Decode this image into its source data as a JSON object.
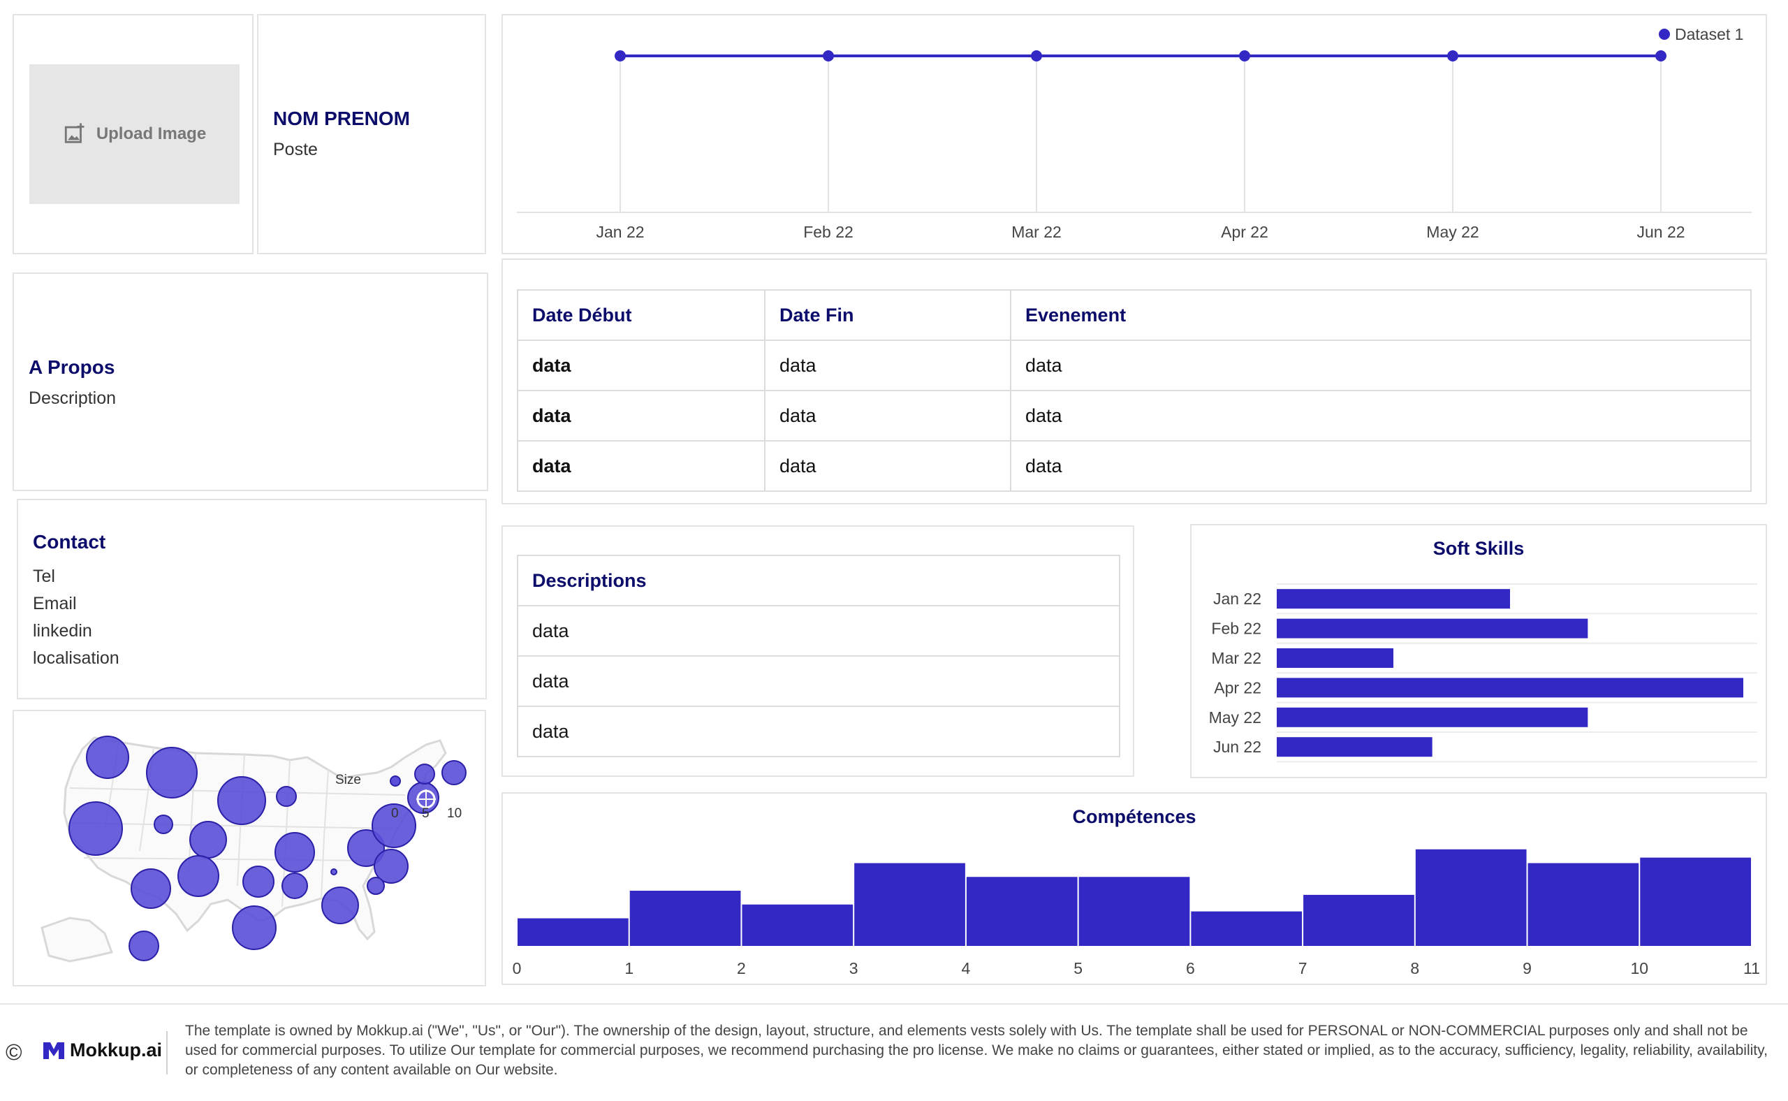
{
  "profile": {
    "upload_label": "Upload Image",
    "name": "NOM PRENOM",
    "position": "Poste"
  },
  "about": {
    "title": "A Propos",
    "description": "Description"
  },
  "contact": {
    "title": "Contact",
    "items": [
      "Tel",
      "Email",
      "linkedin",
      "localisation"
    ]
  },
  "map": {
    "legend_title": "Size",
    "legend_ticks": [
      "0",
      "5",
      "10"
    ]
  },
  "events_table": {
    "headers": [
      "Date Début",
      "Date Fin",
      "Evenement"
    ],
    "rows": [
      [
        "data",
        "data",
        "data"
      ],
      [
        "data",
        "data",
        "data"
      ],
      [
        "data",
        "data",
        "data"
      ]
    ]
  },
  "descriptions_table": {
    "header": "Descriptions",
    "rows": [
      "data",
      "data",
      "data"
    ]
  },
  "colors": {
    "accent": "#3328c4",
    "title": "#0c0c6b",
    "border": "#e4e4e4"
  },
  "chart_data": [
    {
      "type": "line",
      "categories": [
        "Jan 22",
        "Feb 22",
        "Mar 22",
        "Apr 22",
        "May 22",
        "Jun 22"
      ],
      "series": [
        {
          "name": "Dataset 1",
          "values": [
            1,
            1,
            1,
            1,
            1,
            1
          ]
        }
      ],
      "legend": "top-right",
      "grid": true
    },
    {
      "type": "bar",
      "orientation": "horizontal",
      "title": "Soft Skills",
      "categories": [
        "Jan 22",
        "Feb 22",
        "Mar 22",
        "Apr 22",
        "May 22",
        "Jun 22"
      ],
      "values": [
        6,
        8,
        3,
        12,
        8,
        4
      ],
      "xlim": [
        0,
        12
      ]
    },
    {
      "type": "bar",
      "title": "Compétences",
      "x_ticks": [
        "0",
        "1",
        "2",
        "3",
        "4",
        "5",
        "6",
        "7",
        "8",
        "9",
        "10",
        "11"
      ],
      "values": [
        2,
        4,
        3,
        6,
        5,
        5,
        2.5,
        3.7,
        7,
        6,
        6.4
      ],
      "ylim": [
        0,
        8
      ]
    }
  ],
  "footer": {
    "brand": "Mokkup.ai",
    "legal": "The template is owned by Mokkup.ai (\"We\", \"Us\", or \"Our\"). The ownership of the design, layout, structure, and elements vests solely with Us. The template shall be used for PERSONAL or NON-COMMERCIAL purposes only and shall not be used for commercial purposes. To utilize Our template for commercial purposes, we recommend purchasing the pro license. We make no claims or guarantees, either stated or implied, as to the accuracy, sufficiency, legality, reliability, availability, or completeness of any content available on Our website."
  }
}
